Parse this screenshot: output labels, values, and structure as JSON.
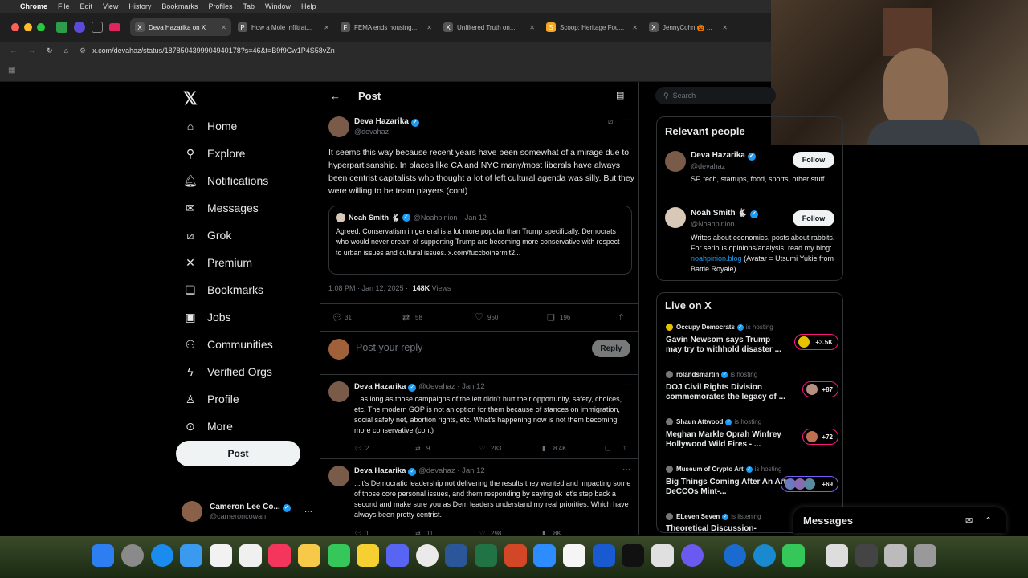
{
  "menubar": {
    "app": "Chrome",
    "items": [
      "File",
      "Edit",
      "View",
      "History",
      "Bookmarks",
      "Profiles",
      "Tab",
      "Window",
      "Help"
    ]
  },
  "tabs": [
    {
      "title": "Deva Hazarika on X",
      "fav": "X",
      "active": true
    },
    {
      "title": "How a Mole Infiltrat...",
      "fav": "P",
      "active": false
    },
    {
      "title": "FEMA ends housing...",
      "fav": "F",
      "active": false
    },
    {
      "title": "Unfiltered Truth on...",
      "fav": "X",
      "active": false
    },
    {
      "title": "Scoop: Heritage Fou...",
      "fav": "S",
      "active": false
    },
    {
      "title": "JennyCohn 🎃 ...",
      "fav": "X",
      "active": false
    }
  ],
  "address": {
    "url": "x.com/devahaz/status/1878504399904940178?s=46&t=B9f9Cw1P4S58vZn"
  },
  "nav": {
    "items": [
      {
        "label": "Home",
        "icon": "home-icon",
        "glyph": "⌂"
      },
      {
        "label": "Explore",
        "icon": "search-icon",
        "glyph": "⚲"
      },
      {
        "label": "Notifications",
        "icon": "bell-icon",
        "glyph": "🔔︎"
      },
      {
        "label": "Messages",
        "icon": "envelope-icon",
        "glyph": "✉"
      },
      {
        "label": "Grok",
        "icon": "grok-icon",
        "glyph": "⧄"
      },
      {
        "label": "Premium",
        "icon": "x-logo-icon",
        "glyph": "✕"
      },
      {
        "label": "Bookmarks",
        "icon": "bookmark-icon",
        "glyph": "❏"
      },
      {
        "label": "Jobs",
        "icon": "briefcase-icon",
        "glyph": "▣"
      },
      {
        "label": "Communities",
        "icon": "people-icon",
        "glyph": "⚇"
      },
      {
        "label": "Verified Orgs",
        "icon": "lightning-icon",
        "glyph": "ϟ"
      },
      {
        "label": "Profile",
        "icon": "person-icon",
        "glyph": "♙"
      },
      {
        "label": "More",
        "icon": "more-circle-icon",
        "glyph": "⊙"
      }
    ],
    "post_label": "Post"
  },
  "account": {
    "name": "Cameron Lee Co...",
    "handle": "@cameroncowan"
  },
  "header": {
    "title": "Post"
  },
  "post": {
    "name": "Deva Hazarika",
    "handle": "@devahaz",
    "text": "It seems this way because recent years have been somewhat of a mirage due to hyperpartisanship. In places like CA and NYC many/most liberals have always been centrist capitalists who thought a lot of left cultural agenda was silly. But they were willing to be team players (cont)",
    "quote": {
      "name": "Noah Smith 🐇",
      "handle": "@Noahpinion",
      "date": "· Jan 12",
      "text": "Agreed. Conservatism in general is a lot more popular than Trump specifically. Democrats who would never dream of supporting Trump are becoming more conservative with respect to urban issues and cultural issues. x.com/fuccboihermit2..."
    },
    "time": "1:08 PM · Jan 12, 2025 ·",
    "views_num": "148K",
    "views_label": "Views",
    "stats": {
      "replies": "31",
      "reposts": "58",
      "likes": "950",
      "bookmarks": "196"
    }
  },
  "compose": {
    "placeholder": "Post your reply",
    "button": "Reply"
  },
  "replies": [
    {
      "name": "Deva Hazarika",
      "handle": "@devahaz · Jan 12",
      "text": "...as long as those campaigns of the left didn't hurt their opportunity, safety, choices, etc. The modern GOP is not an option for them because of stances on immigration, social safety net, abortion rights, etc. What's happening now is not them becoming more conservative (cont)",
      "replies": "2",
      "reposts": "9",
      "likes": "283",
      "views": "8.4K"
    },
    {
      "name": "Deva Hazarika",
      "handle": "@devahaz · Jan 12",
      "text": "...it's Democratic leadership not delivering the results they wanted and impacting some of those core personal issues, and them responding by saying ok let's step back a second and make sure you as Dem leaders understand my real priorities. Which have always been pretty centrist.",
      "replies": "1",
      "reposts": "11",
      "likes": "298",
      "views": "8K"
    }
  ],
  "search": {
    "placeholder": "Search"
  },
  "relevant": {
    "title": "Relevant people",
    "follow": "Follow",
    "people": [
      {
        "name": "Deva Hazarika",
        "handle": "@devahaz",
        "bio": "SF, tech, startups, food, sports, other stuff"
      },
      {
        "name": "Noah Smith 🐇",
        "handle": "@Noahpinion",
        "bio": "Writes about economics, posts about rabbits. For serious opinions/analysis, read my blog:",
        "link": "noahpinion.blog",
        "bio_after": "(Avatar = Utsumi Yukie from Battle Royale)"
      }
    ]
  },
  "live": {
    "title": "Live on X",
    "items": [
      {
        "host": "Occupy Democrats",
        "status": "is hosting",
        "title": "Gavin Newsom says Trump may try to withhold disaster ...",
        "count": "+3.5K"
      },
      {
        "host": "rolandsmartin",
        "status": "is hosting",
        "title": "DOJ Civil Rights Division commemorates the legacy of ...",
        "count": "+87"
      },
      {
        "host": "Shaun Attwood",
        "status": "is hosting",
        "title": "Meghan Markle Oprah Winfrey Hollywood Wild Fires - ...",
        "count": "+72"
      },
      {
        "host": "Museum of Crypto Art",
        "status": "is hosting",
        "title": "Big Things Coming After An Art DeCCOs Mint-...",
        "count": "+69"
      },
      {
        "host": "ELeven Seven",
        "status": "is listening",
        "title": "Theoretical Discussion-",
        "count": ""
      }
    ]
  },
  "messages": {
    "label": "Messages"
  },
  "colors": {
    "accent": "#1d9bf0",
    "live": "#f91880"
  }
}
